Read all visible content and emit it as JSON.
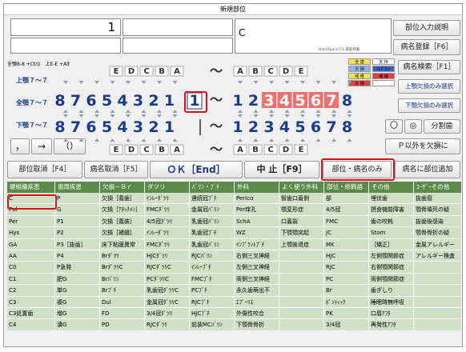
{
  "window": {
    "title": "新規部位"
  },
  "fields": {
    "count_value": "1",
    "part_value": "C",
    "backspace_hint": "BackSpaceで1 病名移動"
  },
  "buttons": {
    "part_input_help": "部位入力説明",
    "register_disease": "病名登録［F6］",
    "search_disease": "病名検索［F1］",
    "select_upper_missing": "上顎欠損のみ選択",
    "select_lower_missing": "下顎欠損のみ選択",
    "circle": "〇",
    "double_circle": "◎",
    "split_tooth": "分割歯",
    "comma": "，",
    "arrow": "→",
    "paren": "（）",
    "except_p_missing": "Ｐ以外を欠損に",
    "cancel_part": "部位取消［F4］",
    "cancel_disease": "病名取消［F5］",
    "ok": "ＯＫ［End］",
    "abort": "中 止［F9］",
    "part_disease_only": "部位・病名のみ",
    "add_part_to_disease": "病名に部位追加"
  },
  "labels": {
    "shortcut_hint": "全顎8-8 +Ctrl/　上E-E +Alt",
    "upper_jaw": "上顎７～７",
    "full_jaw": "全顎７～７",
    "lower_jaw": "下顎７～７"
  },
  "legend": {
    "items": [
      {
        "text": "全 歯",
        "color": "#f2e05a"
      },
      {
        "text": "支 持",
        "color": "#ffffff"
      },
      {
        "text": "欠 損",
        "color": "#8ab4ee"
      },
      {
        "text": "ｲﾝﾌﾟﾗﾝﾄ",
        "color": "#3a5fc8"
      },
      {
        "text": "残 根",
        "color": "#f2e05a"
      },
      {
        "text": "補 綴",
        "color": "#e04040"
      },
      {
        "text": "欠 損",
        "color": "#e04040"
      },
      {
        "text": "",
        "color": "#ffffff"
      }
    ]
  },
  "teeth": {
    "deciduous_letters_right": [
      "E",
      "D",
      "C",
      "B",
      "A"
    ],
    "deciduous_letters_left": [
      "A",
      "B",
      "C",
      "D",
      "E"
    ],
    "upper_right": [
      "8",
      "7",
      "6",
      "5",
      "4",
      "3",
      "2",
      "1"
    ],
    "upper_left": [
      "1",
      "2",
      "3",
      "4",
      "5",
      "6",
      "7",
      "8"
    ],
    "lower_right": [
      "8",
      "7",
      "6",
      "5",
      "4",
      "3",
      "2",
      "1"
    ],
    "lower_left": [
      "1",
      "2",
      "3",
      "4",
      "5",
      "6",
      "7",
      "8"
    ],
    "separator": "～",
    "selected_tooth": "1",
    "highlight_color": "#f07070",
    "tooth_color": "#1a3c8c"
  },
  "table": {
    "headers": [
      "硬組織疾患",
      "歯周疾患",
      "欠損－Ｂｒ",
      "ダツリ",
      "ﾊﾞﾘﾝ・ﾌﾞﾁ",
      "外科",
      "よく使う外科",
      "部位・修飾語",
      "その他",
      "ﾕｰｻﾞｰその他"
    ],
    "rows": [
      [
        "C",
        "P",
        "欠損［義歯］",
        "ｲﾝﾚｰﾀﾞﾂﾘ",
        "連続冠ﾌﾞﾁ",
        "Perico",
        "智歯口蓋側",
        "部",
        "埋伏歯",
        "抜歯窩"
      ],
      [
        "Pul",
        "G",
        "欠損［ｱﾀｯﾁﾒﾝ］",
        "FMCﾀﾞﾂﾘ",
        "金属冠ﾊﾞﾘﾝ",
        "Per痒孔",
        "顎変形症",
        "4/5冠",
        "摂食機能障害",
        "顎骨壊死の疑"
      ],
      [
        "Per",
        "P1",
        "欠損［義装］",
        "4/5冠ﾀﾞﾂﾘ",
        "乳歯冠ﾊﾞﾘﾝ",
        "SchA",
        "口蓋裂",
        "FMC",
        "歯の咬耗",
        "抜歯後感染"
      ],
      [
        "Hys",
        "P2",
        "欠損［補綴］",
        "ｲﾝﾚｰﾀﾞﾂﾘ",
        "乳歯冠ﾌﾞﾁ",
        "WZ",
        "下顎顎突起",
        "JC",
        "Stom",
        "顎骨骨折の疑"
      ],
      [
        "GA",
        "P3［抜歯］",
        "床下粘膜異常",
        "FMCﾀﾞﾂﾘ",
        "乳歯冠ﾊﾞﾘﾝ",
        "ｲﾝﾌﾟﾗﾝﾄﾌﾞﾁ",
        "上顎後退症",
        "MK",
        "［矯正］",
        "金属アレルギー"
      ],
      [
        "AA",
        "P4",
        "Brﾀﾞﾂﾘ",
        "HJCﾀﾞﾂﾘ",
        "RJCﾊﾞﾘﾝ",
        "右側三叉神経",
        "",
        "HJC",
        "左側顎関節症",
        "アレルギー検査"
      ],
      [
        "C0",
        "P急発",
        "BrﾀﾞﾂﾘC",
        "RJCﾀﾞﾂﾘC",
        "ｲﾝﾚｰﾌﾞﾁ",
        "左側三叉神経",
        "",
        "RJC",
        "右側顎関節症",
        ""
      ],
      [
        "C1",
        "肥G",
        "Brﾊﾞﾘﾝ",
        "PCﾀﾞﾂﾘC",
        "FMCﾌﾞﾁ",
        "両側三叉神経",
        "",
        "PC",
        "両側顎関節症",
        ""
      ],
      [
        "C2",
        "単G",
        "Brﾌﾞﾁ",
        "乳歯冠ﾀﾞﾂﾘC",
        "PCﾌﾞﾁ",
        "永久歯萌出不",
        "",
        "Br",
        "歯ぎしり",
        ""
      ],
      [
        "C3",
        "複G",
        "Dul",
        "金属冠ﾀﾞﾂﾘC",
        "RJCﾌﾞﾁ",
        "ｴﾌﾟｰﾘｽ",
        "",
        "ﾎﾟﾝﾃｨｯｸ",
        "睡眠時無呼吸",
        ""
      ],
      [
        "C3処置歯",
        "増G",
        "FD",
        "3/4冠ﾀﾞﾂﾘ",
        "HJCﾌﾞﾁ",
        "外傷性咬合",
        "",
        "PK",
        "口唇ｱﾌﾀ",
        ""
      ],
      [
        "C4",
        "潰G",
        "PD",
        "RJCﾀﾞﾂﾘ",
        "前装MCﾊﾞﾘﾝ",
        "下顎骨骨折",
        "",
        "3/4冠",
        "再発性ｱﾌﾀ",
        ""
      ]
    ],
    "header_color": "#5c8a4a",
    "cell_color": "#cfe0c6"
  },
  "colors": {
    "accent_red": "#e0101a",
    "navy": "#1a3c8c"
  }
}
